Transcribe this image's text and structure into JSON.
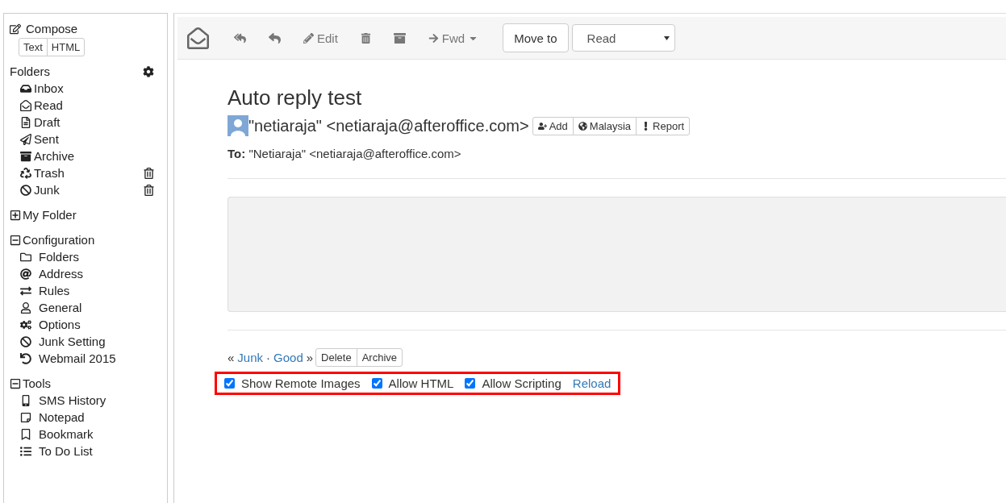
{
  "sidebar": {
    "compose": {
      "label": "Compose",
      "formats": [
        "Text",
        "HTML"
      ]
    },
    "folders": {
      "title": "Folders",
      "items": [
        {
          "label": "Inbox",
          "kind": "plain"
        },
        {
          "label": "Read",
          "kind": "plain"
        },
        {
          "label": "Draft",
          "kind": "plain"
        },
        {
          "label": "Sent",
          "kind": "plain"
        },
        {
          "label": "Archive",
          "kind": "plain"
        },
        {
          "label": "Trash",
          "kind": "emptyable"
        },
        {
          "label": "Junk",
          "kind": "emptyable"
        }
      ]
    },
    "groups": [
      {
        "label": "My Folder",
        "expanded": false
      },
      {
        "label": "Configuration",
        "expanded": true,
        "children": [
          {
            "label": "Folders"
          },
          {
            "label": "Address"
          },
          {
            "label": "Rules"
          },
          {
            "label": "General"
          },
          {
            "label": "Options"
          },
          {
            "label": "Junk Setting"
          },
          {
            "label": "Webmail 2015"
          }
        ]
      },
      {
        "label": "Tools",
        "expanded": true,
        "children": [
          {
            "label": "SMS History"
          },
          {
            "label": "Notepad"
          },
          {
            "label": "Bookmark"
          },
          {
            "label": "To Do List"
          }
        ]
      }
    ]
  },
  "toolbar": {
    "edit": "Edit",
    "forward": "Fwd",
    "move_to": "Move to",
    "folder_select": {
      "value": "Read"
    }
  },
  "message": {
    "subject": "Auto reply test",
    "from": "\"netiaraja\" <netiaraja@afteroffice.com>",
    "sender_actions": [
      "Add",
      "Malaysia",
      "Report"
    ],
    "to_label": "To:",
    "to": "\"Netiaraja\" <netiaraja@afteroffice.com>"
  },
  "classify": {
    "open_quote": "«",
    "junk": "Junk",
    "separator": "·",
    "good": "Good",
    "close_quote": "»",
    "buttons": [
      "Delete",
      "Archive"
    ]
  },
  "options": [
    {
      "label": "Show Remote Images",
      "checked": true
    },
    {
      "label": "Allow HTML",
      "checked": true
    },
    {
      "label": "Allow Scripting",
      "checked": true
    }
  ],
  "reload": "Reload"
}
